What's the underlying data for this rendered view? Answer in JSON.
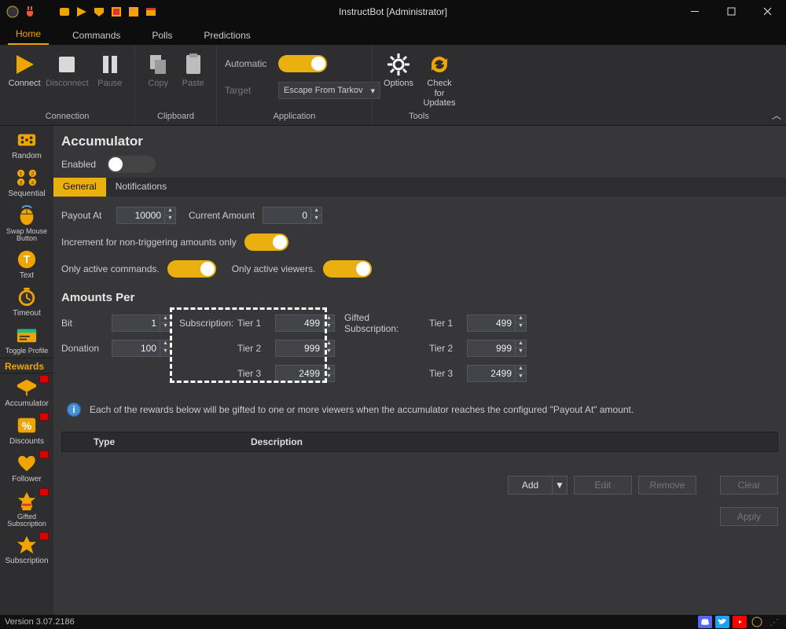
{
  "window": {
    "title": "InstructBot [Administrator]"
  },
  "maintabs": {
    "home": "Home",
    "commands": "Commands",
    "polls": "Polls",
    "predictions": "Predictions"
  },
  "ribbon": {
    "connection": {
      "label": "Connection",
      "connect": "Connect",
      "disconnect": "Disconnect",
      "pause": "Pause"
    },
    "clipboard": {
      "label": "Clipboard",
      "copy": "Copy",
      "paste": "Paste"
    },
    "application": {
      "label": "Application",
      "automatic": "Automatic",
      "target": "Target",
      "target_value": "Escape From Tarkov"
    },
    "tools": {
      "label": "Tools",
      "options": "Options",
      "check_updates": "Check for\nUpdates"
    }
  },
  "nav": {
    "random": "Random",
    "sequential": "Sequential",
    "swap_mouse": "Swap Mouse Button",
    "text": "Text",
    "timeout": "Timeout",
    "toggle_profile": "Toggle Profile",
    "rewards_header": "Rewards",
    "accumulator": "Accumulator",
    "discounts": "Discounts",
    "follower": "Follower",
    "gifted_sub": "Gifted Subscription",
    "subscription": "Subscription"
  },
  "accum": {
    "title": "Accumulator",
    "enabled_label": "Enabled",
    "tabs": {
      "general": "General",
      "notifications": "Notifications"
    },
    "payout_at_label": "Payout At",
    "payout_at": "10000",
    "current_amount_label": "Current Amount",
    "current_amount": "0",
    "increment_label": "Increment for non-triggering amounts only",
    "only_cmds_label": "Only active commands.",
    "only_viewers_label": "Only active viewers.",
    "amounts_title": "Amounts Per",
    "bit_label": "Bit",
    "bit": "1",
    "donation_label": "Donation",
    "donation": "100",
    "subscription_label": "Subscription:",
    "gifted_label": "Gifted Subscription:",
    "tier1": "Tier 1",
    "tier2": "Tier 2",
    "tier3": "Tier 3",
    "sub_t1": "499",
    "sub_t2": "999",
    "sub_t3": "2499",
    "gift_t1": "499",
    "gift_t2": "999",
    "gift_t3": "2499",
    "info": "Each of the rewards below will be gifted to one or more viewers when the accumulator reaches the configured \"Payout At\" amount.",
    "table": {
      "type": "Type",
      "description": "Description"
    },
    "buttons": {
      "add": "Add",
      "edit": "Edit",
      "remove": "Remove",
      "clear": "Clear",
      "apply": "Apply"
    }
  },
  "status": {
    "version": "Version 3.07.2186"
  }
}
